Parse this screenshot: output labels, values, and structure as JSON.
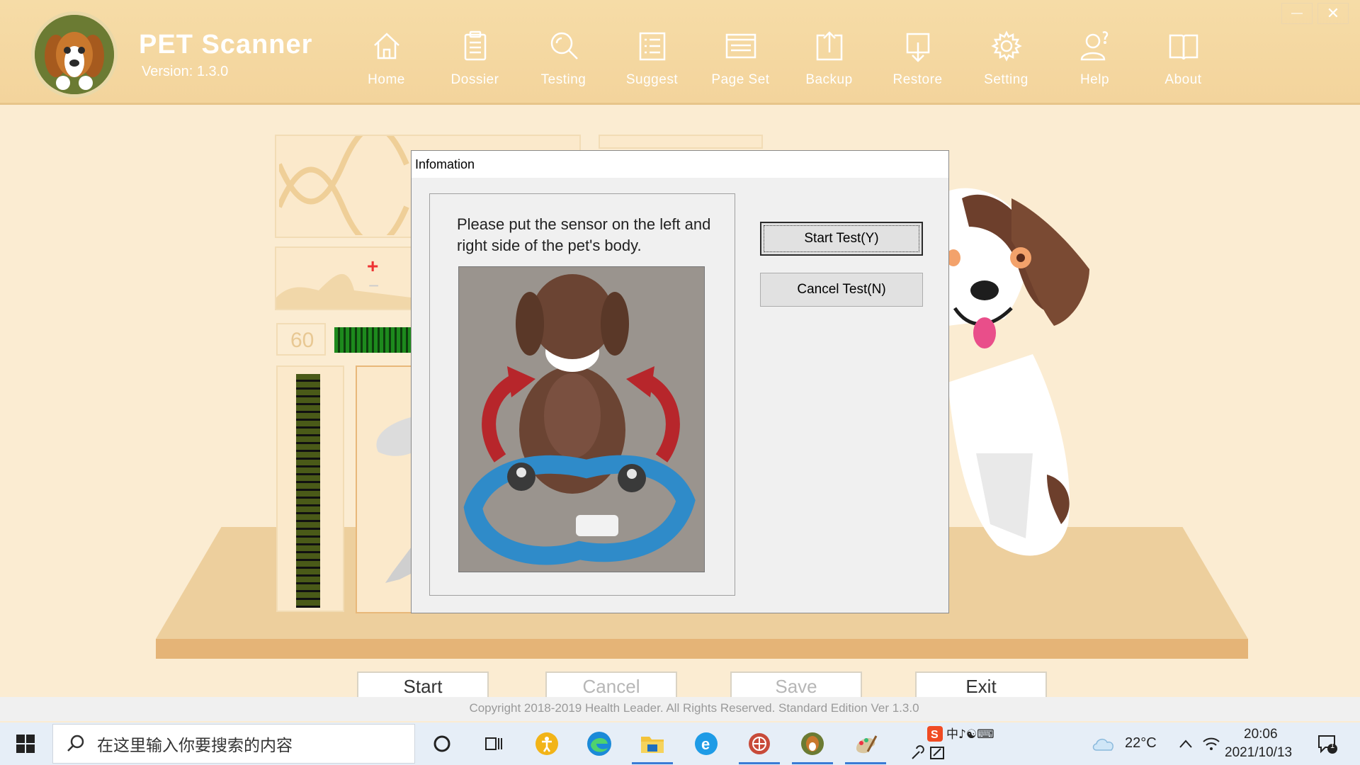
{
  "header": {
    "title": "PET Scanner",
    "version": "Version: 1.3.0",
    "nav": [
      {
        "label": "Home",
        "icon": "home-icon"
      },
      {
        "label": "Dossier",
        "icon": "clipboard-icon"
      },
      {
        "label": "Testing",
        "icon": "magnifier-icon"
      },
      {
        "label": "Suggest",
        "icon": "list-icon"
      },
      {
        "label": "Page Set",
        "icon": "page-icon"
      },
      {
        "label": "Backup",
        "icon": "upload-icon"
      },
      {
        "label": "Restore",
        "icon": "download-icon"
      },
      {
        "label": "Setting",
        "icon": "gear-icon"
      },
      {
        "label": "Help",
        "icon": "user-question-icon"
      },
      {
        "label": "About",
        "icon": "book-icon"
      }
    ],
    "window_controls": {
      "minimize": "—",
      "close": "✕"
    }
  },
  "background": {
    "stepper_plus": "+",
    "stepper_minus": "−",
    "rate_value": "60"
  },
  "dialog": {
    "title": "Infomation",
    "message": "Please put the sensor on the left and right side of the pet's body.",
    "start_button": "Start Test(Y)",
    "cancel_button": "Cancel Test(N)"
  },
  "bottom_buttons": {
    "start": "Start",
    "cancel": "Cancel",
    "save": "Save",
    "exit": "Exit"
  },
  "footer": {
    "copyright": "Copyright 2018-2019 Health Leader. All Rights Reserved.  Standard Edition Ver 1.3.0"
  },
  "taskbar": {
    "search_placeholder": "在这里输入你要搜索的内容",
    "weather": "22°C",
    "time": "20:06",
    "date": "2021/10/13",
    "notification_count": "1"
  },
  "colors": {
    "header_bg": "#f3d49c",
    "page_bg": "#fbecd2",
    "nav_text": "#ffffff",
    "accent_blue": "#3a7bd5"
  }
}
